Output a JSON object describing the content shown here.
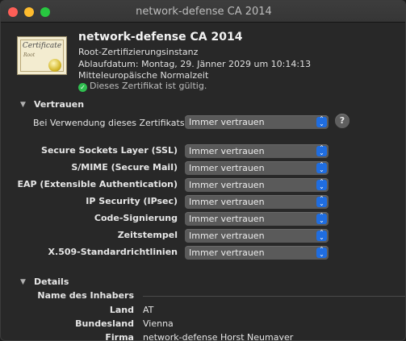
{
  "window": {
    "title": "network-defense CA 2014"
  },
  "header": {
    "name": "network-defense CA 2014",
    "type": "Root-Zertifizierungsinstanz",
    "expiry": "Ablaufdatum: Montag, 29. Jänner 2029 um 10:14:13",
    "timezone": "Mitteleuropäische Normalzeit",
    "validity": "Dieses Zertifikat ist gültig.",
    "icon": {
      "title": "Certificate",
      "subtitle": "Root"
    }
  },
  "trust": {
    "section_title": "Vertrauen",
    "when_label": "Bei Verwendung dieses Zertifikats:",
    "when_value": "Immer vertrauen",
    "help_label": "?",
    "rows": [
      {
        "label": "Secure Sockets Layer (SSL)",
        "value": "Immer vertrauen"
      },
      {
        "label": "S/MIME (Secure Mail)",
        "value": "Immer vertrauen"
      },
      {
        "label": "EAP (Extensible Authentication)",
        "value": "Immer vertrauen"
      },
      {
        "label": "IP Security (IPsec)",
        "value": "Immer vertrauen"
      },
      {
        "label": "Code-Signierung",
        "value": "Immer vertrauen"
      },
      {
        "label": "Zeitstempel",
        "value": "Immer vertrauen"
      },
      {
        "label": "X.509-Standardrichtlinien",
        "value": "Immer vertrauen"
      }
    ]
  },
  "details": {
    "section_title": "Details",
    "subject_heading": "Name des Inhabers",
    "fields": [
      {
        "label": "Land",
        "value": "AT"
      },
      {
        "label": "Bundesland",
        "value": "Vienna"
      },
      {
        "label": "Firma",
        "value": "network-defense Horst Neumayer"
      }
    ]
  },
  "colors": {
    "accent": "#1f6de0",
    "valid": "#2fbe4f"
  }
}
